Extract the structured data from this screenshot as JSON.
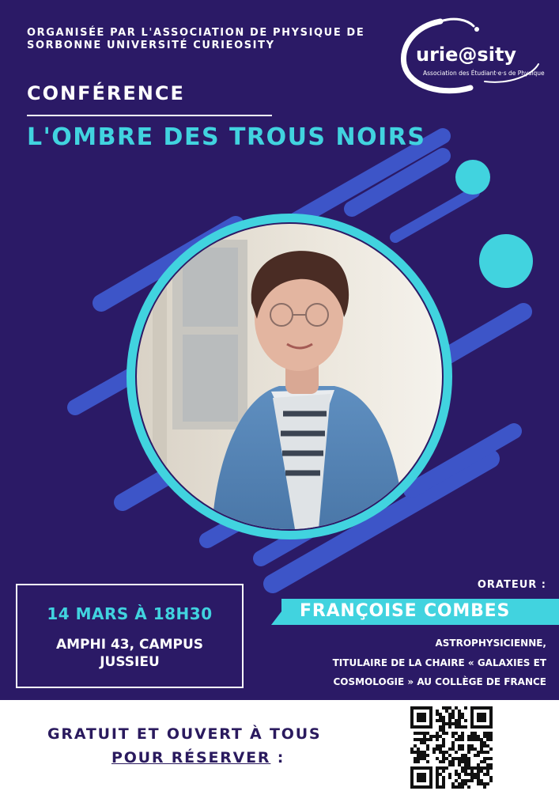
{
  "organizer": {
    "line1": "ORGANISÉE PAR L'ASSOCIATION DE PHYSIQUE DE",
    "line2": "SORBONNE UNIVERSITÉ CURIEOSITY"
  },
  "logo": {
    "wordmark": "urie@sity",
    "tagline": "Association des Étudiant·e·s de Physique"
  },
  "event": {
    "type_label": "CONFÉRENCE",
    "title": "L'OMBRE DES TROUS NOIRS",
    "date_time": "14 MARS À 18H30",
    "venue_line1": "AMPHI 43, CAMPUS",
    "venue_line2": "JUSSIEU"
  },
  "speaker": {
    "label": "ORATEUR :",
    "name": "FRANÇOISE COMBES",
    "desc_line1": "ASTROPHYSICIENNE,",
    "desc_line2": "TITULAIRE DE LA CHAIRE « GALAXIES ET",
    "desc_line3": "COSMOLOGIE » AU COLLÈGE DE FRANCE"
  },
  "footer": {
    "free_text": "GRATUIT ET OUVERT À TOUS",
    "reserve_label": "POUR RÉSERVER",
    "reserve_suffix": " :"
  },
  "colors": {
    "background": "#2b1a66",
    "accent": "#41d3df",
    "stripe": "#3d55c8",
    "text_light": "#ffffff",
    "text_dark": "#2a1a5e"
  },
  "icons": {
    "qr": "qr-code-icon",
    "logo": "curieosity-logo-icon"
  }
}
